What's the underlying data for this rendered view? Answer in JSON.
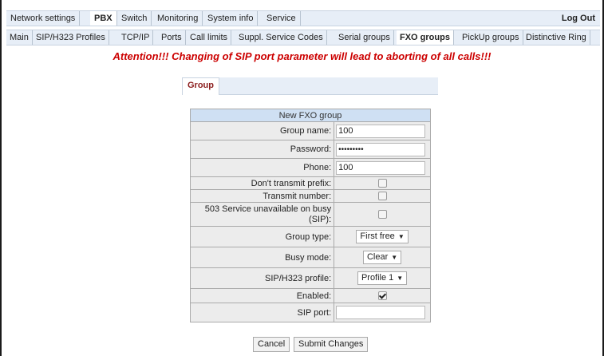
{
  "topnav": {
    "items": [
      "Network settings",
      "PBX",
      "Switch",
      "Monitoring",
      "System info",
      "Service"
    ],
    "active": "PBX",
    "logout": "Log Out"
  },
  "subnav": {
    "items": [
      "Main",
      "SIP/H323 Profiles",
      "TCP/IP",
      "Ports",
      "Call limits",
      "Suppl. Service Codes",
      "Serial groups",
      "FXO groups",
      "PickUp groups",
      "Distinctive Ring"
    ],
    "active": "FXO groups"
  },
  "attention": "Attention!!! Changing of SIP port parameter will lead to aborting of all calls!!!",
  "tab": {
    "label": "Group"
  },
  "form": {
    "title": "New FXO group",
    "group_name_label": "Group name:",
    "group_name_value": "100",
    "password_label": "Password:",
    "password_value": "•••••••••",
    "phone_label": "Phone:",
    "phone_value": "100",
    "dont_transmit_prefix_label": "Don't transmit prefix:",
    "dont_transmit_prefix_checked": false,
    "transmit_number_label": "Transmit number:",
    "transmit_number_checked": false,
    "service_unavailable_label": "503 Service unavailable on busy (SIP):",
    "service_unavailable_checked": false,
    "group_type_label": "Group type:",
    "group_type_value": "First free",
    "busy_mode_label": "Busy mode:",
    "busy_mode_value": "Clear",
    "profile_label": "SIP/H323 profile:",
    "profile_value": "Profile 1",
    "enabled_label": "Enabled:",
    "enabled_checked": true,
    "sip_port_label": "SIP port:",
    "sip_port_value": ""
  },
  "buttons": {
    "cancel": "Cancel",
    "submit": "Submit Changes"
  },
  "icons": {
    "dropdown": "chevron-down-icon",
    "check": "checkmark-icon"
  }
}
